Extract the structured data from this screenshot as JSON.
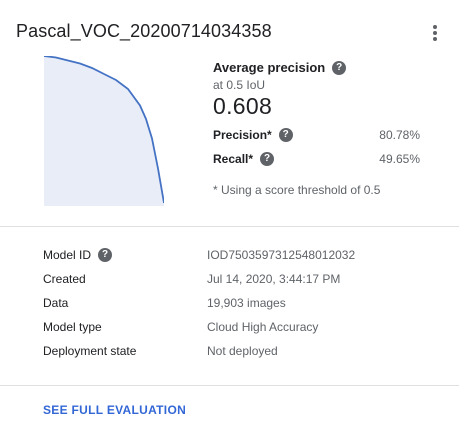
{
  "card": {
    "title": "Pascal_VOC_20200714034358",
    "more_icon": "more-vert-icon"
  },
  "metrics": {
    "ap_title": "Average precision",
    "ap_subtitle": "at 0.5 IoU",
    "ap_value": "0.608",
    "precision_label": "Precision*",
    "precision_value": "80.78%",
    "recall_label": "Recall*",
    "recall_value": "49.65%",
    "note": "* Using a score threshold of 0.5",
    "help_icon": "help-icon"
  },
  "chart_data": {
    "type": "area",
    "x": [
      0.0,
      0.1,
      0.2,
      0.3,
      0.4,
      0.5,
      0.6,
      0.7,
      0.8,
      0.85,
      0.9,
      0.95,
      1.0
    ],
    "y": [
      1.0,
      0.99,
      0.97,
      0.95,
      0.92,
      0.88,
      0.84,
      0.78,
      0.67,
      0.58,
      0.45,
      0.25,
      0.02
    ],
    "xlim": [
      0,
      1
    ],
    "ylim": [
      0,
      1
    ],
    "line_color": "#4472c4",
    "fill_color": "#e8edf8",
    "grid": false
  },
  "details": [
    {
      "label": "Model ID",
      "value": "IOD7503597312548012032",
      "help": true
    },
    {
      "label": "Created",
      "value": "Jul 14, 2020, 3:44:17 PM",
      "help": false
    },
    {
      "label": "Data",
      "value": "19,903 images",
      "help": false
    },
    {
      "label": "Model type",
      "value": "Cloud High Accuracy",
      "help": false
    },
    {
      "label": "Deployment state",
      "value": "Not deployed",
      "help": false
    }
  ],
  "footer": {
    "link": "SEE FULL EVALUATION",
    "link_color": "#3367d6"
  }
}
